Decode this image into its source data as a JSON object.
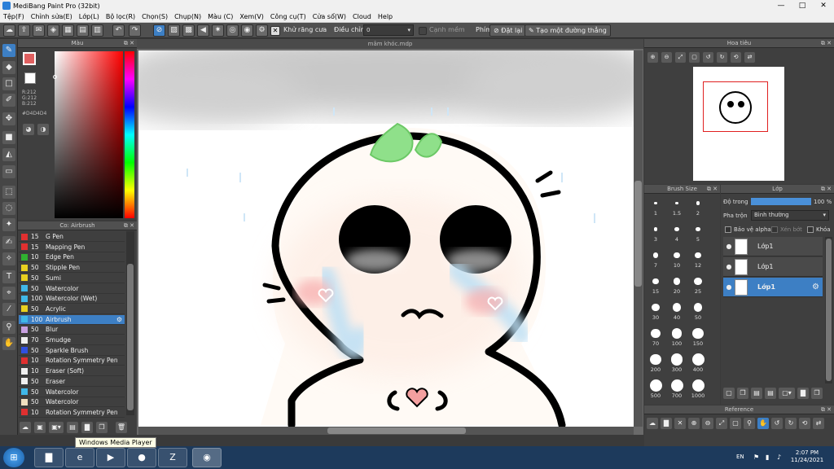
{
  "window": {
    "title": "MediBang Paint Pro (32bit)",
    "minimize": "—",
    "maximize": "□",
    "close": "✕"
  },
  "menu": [
    "Tệp(F)",
    "Chỉnh sửa(E)",
    "Lớp(L)",
    "Bộ lọc(R)",
    "Chọn(S)",
    "Chụp(N)",
    "Màu (C)",
    "Xem(V)",
    "Công cụ(T)",
    "Cửa sổ(W)",
    "Cloud",
    "Help"
  ],
  "toolbar": {
    "antialias_label": "Khử răng cưa",
    "adjust_label": "Điều chỉnh",
    "adjust_value": "0",
    "smooth_label": "Cạnh mềm",
    "key_label": "Phím",
    "reset_label": "Đặt lại",
    "straight_line_label": "Tạo một đường thẳng"
  },
  "color_panel": {
    "title": "Màu",
    "r": "R:212",
    "g": "G:212",
    "b": "B:212",
    "hex": "#D4D4D4",
    "accent": "#3d7fc4"
  },
  "brush_panel": {
    "title": "Co: Airbrush",
    "items": [
      {
        "size": "15",
        "name": "G Pen",
        "color": "#e03030"
      },
      {
        "size": "15",
        "name": "Mapping Pen",
        "color": "#e03030"
      },
      {
        "size": "10",
        "name": "Edge Pen",
        "color": "#30b030"
      },
      {
        "size": "50",
        "name": "Stipple Pen",
        "color": "#e8d020"
      },
      {
        "size": "50",
        "name": "Sumi",
        "color": "#e8d020"
      },
      {
        "size": "50",
        "name": "Watercolor",
        "color": "#40b8e8"
      },
      {
        "size": "100",
        "name": "Watercolor (Wet)",
        "color": "#40b8e8"
      },
      {
        "size": "50",
        "name": "Acrylic",
        "color": "#e8d020"
      },
      {
        "size": "100",
        "name": "Airbrush",
        "color": "#40b8e8"
      },
      {
        "size": "50",
        "name": "Blur",
        "color": "#c8a0e0"
      },
      {
        "size": "70",
        "name": "Smudge",
        "color": "#f0f0f0"
      },
      {
        "size": "50",
        "name": "Sparkle Brush",
        "color": "#3050e0"
      },
      {
        "size": "10",
        "name": "Rotation Symmetry Pen",
        "color": "#e03030"
      },
      {
        "size": "10",
        "name": "Eraser (Soft)",
        "color": "#f0f0f0"
      },
      {
        "size": "50",
        "name": "Eraser",
        "color": "#f0f0f0"
      },
      {
        "size": "50",
        "name": "Watercolor",
        "color": "#40b8e8"
      },
      {
        "size": "50",
        "name": "Watercolor",
        "color": "#f0e0c0"
      },
      {
        "size": "10",
        "name": "Rotation Symmetry Pen",
        "color": "#e03030"
      }
    ],
    "selected_index": 8
  },
  "canvas": {
    "document_title": "mâm khóc.mdp"
  },
  "navigator": {
    "title": "Hoa tiêu"
  },
  "brush_size": {
    "title": "Brush Size",
    "sizes": [
      "1",
      "1.5",
      "2",
      "3",
      "4",
      "5",
      "7",
      "10",
      "12",
      "15",
      "20",
      "25",
      "30",
      "40",
      "50",
      "70",
      "100",
      "150",
      "200",
      "300",
      "400",
      "500",
      "700",
      "1000"
    ]
  },
  "layers": {
    "title": "Lớp",
    "opacity_label": "Độ trong",
    "opacity_value": "100 %",
    "opacity_fraction": 1.0,
    "blend_label": "Pha trộn",
    "blend_value": "Bình thường",
    "protect_alpha": "Bảo vệ alpha",
    "clip": "Xén bớt",
    "lock": "Khóa",
    "items": [
      {
        "name": "Lớp1",
        "selected": false
      },
      {
        "name": "Lớp1",
        "selected": false
      },
      {
        "name": "Lớp1",
        "selected": true
      }
    ]
  },
  "reference": {
    "title": "Reference"
  },
  "taskbar": {
    "tooltip": "Windows Media Player",
    "lang": "EN",
    "time": "2:07 PM",
    "date": "11/24/2021"
  }
}
